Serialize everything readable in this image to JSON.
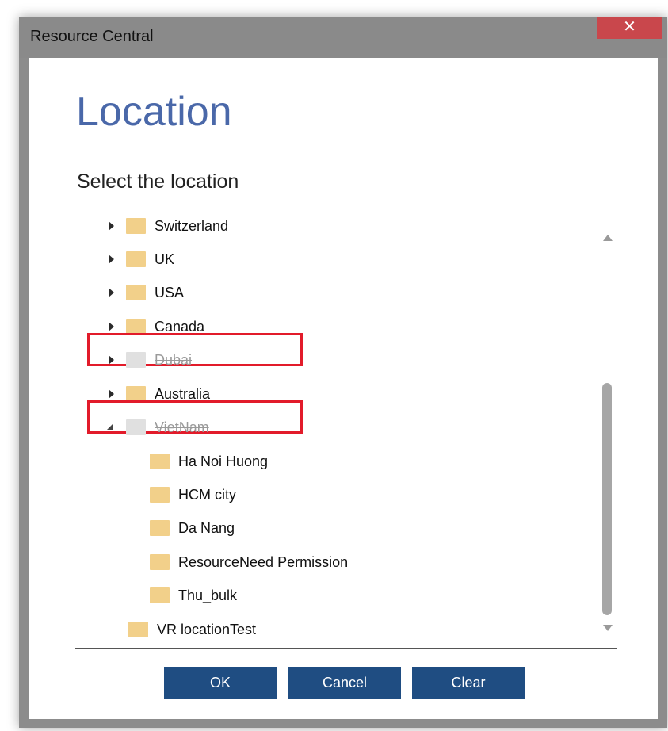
{
  "window": {
    "title": "Resource Central",
    "close_glyph": "✕"
  },
  "dialog": {
    "heading": "Location",
    "subheading": "Select the location"
  },
  "tree": {
    "nodes": [
      {
        "label": "Switzerland",
        "state": "collapsed",
        "disabled": false
      },
      {
        "label": "UK",
        "state": "collapsed",
        "disabled": false
      },
      {
        "label": "USA",
        "state": "collapsed",
        "disabled": false
      },
      {
        "label": "Canada",
        "state": "collapsed",
        "disabled": false
      },
      {
        "label": "Dubai",
        "state": "collapsed",
        "disabled": true,
        "highlighted": true
      },
      {
        "label": "Australia",
        "state": "collapsed",
        "disabled": false
      },
      {
        "label": "VietNam",
        "state": "expanded",
        "disabled": true,
        "highlighted": true
      },
      {
        "label": "Ha Noi Huong",
        "state": "leaf",
        "disabled": false
      },
      {
        "label": "HCM city",
        "state": "leaf",
        "disabled": false
      },
      {
        "label": "Da Nang",
        "state": "leaf",
        "disabled": false
      },
      {
        "label": "ResourceNeed Permission",
        "state": "leaf",
        "disabled": false
      },
      {
        "label": "Thu_bulk",
        "state": "leaf",
        "disabled": false
      },
      {
        "label": "VR locationTest",
        "state": "leaf",
        "disabled": false
      }
    ]
  },
  "buttons": {
    "ok": "OK",
    "cancel": "Cancel",
    "clear": "Clear"
  },
  "colors": {
    "heading": "#4a68a9",
    "button": "#1f4d82",
    "highlight": "#e21b2a",
    "folder": "#f2d08a",
    "close": "#c9474c"
  }
}
